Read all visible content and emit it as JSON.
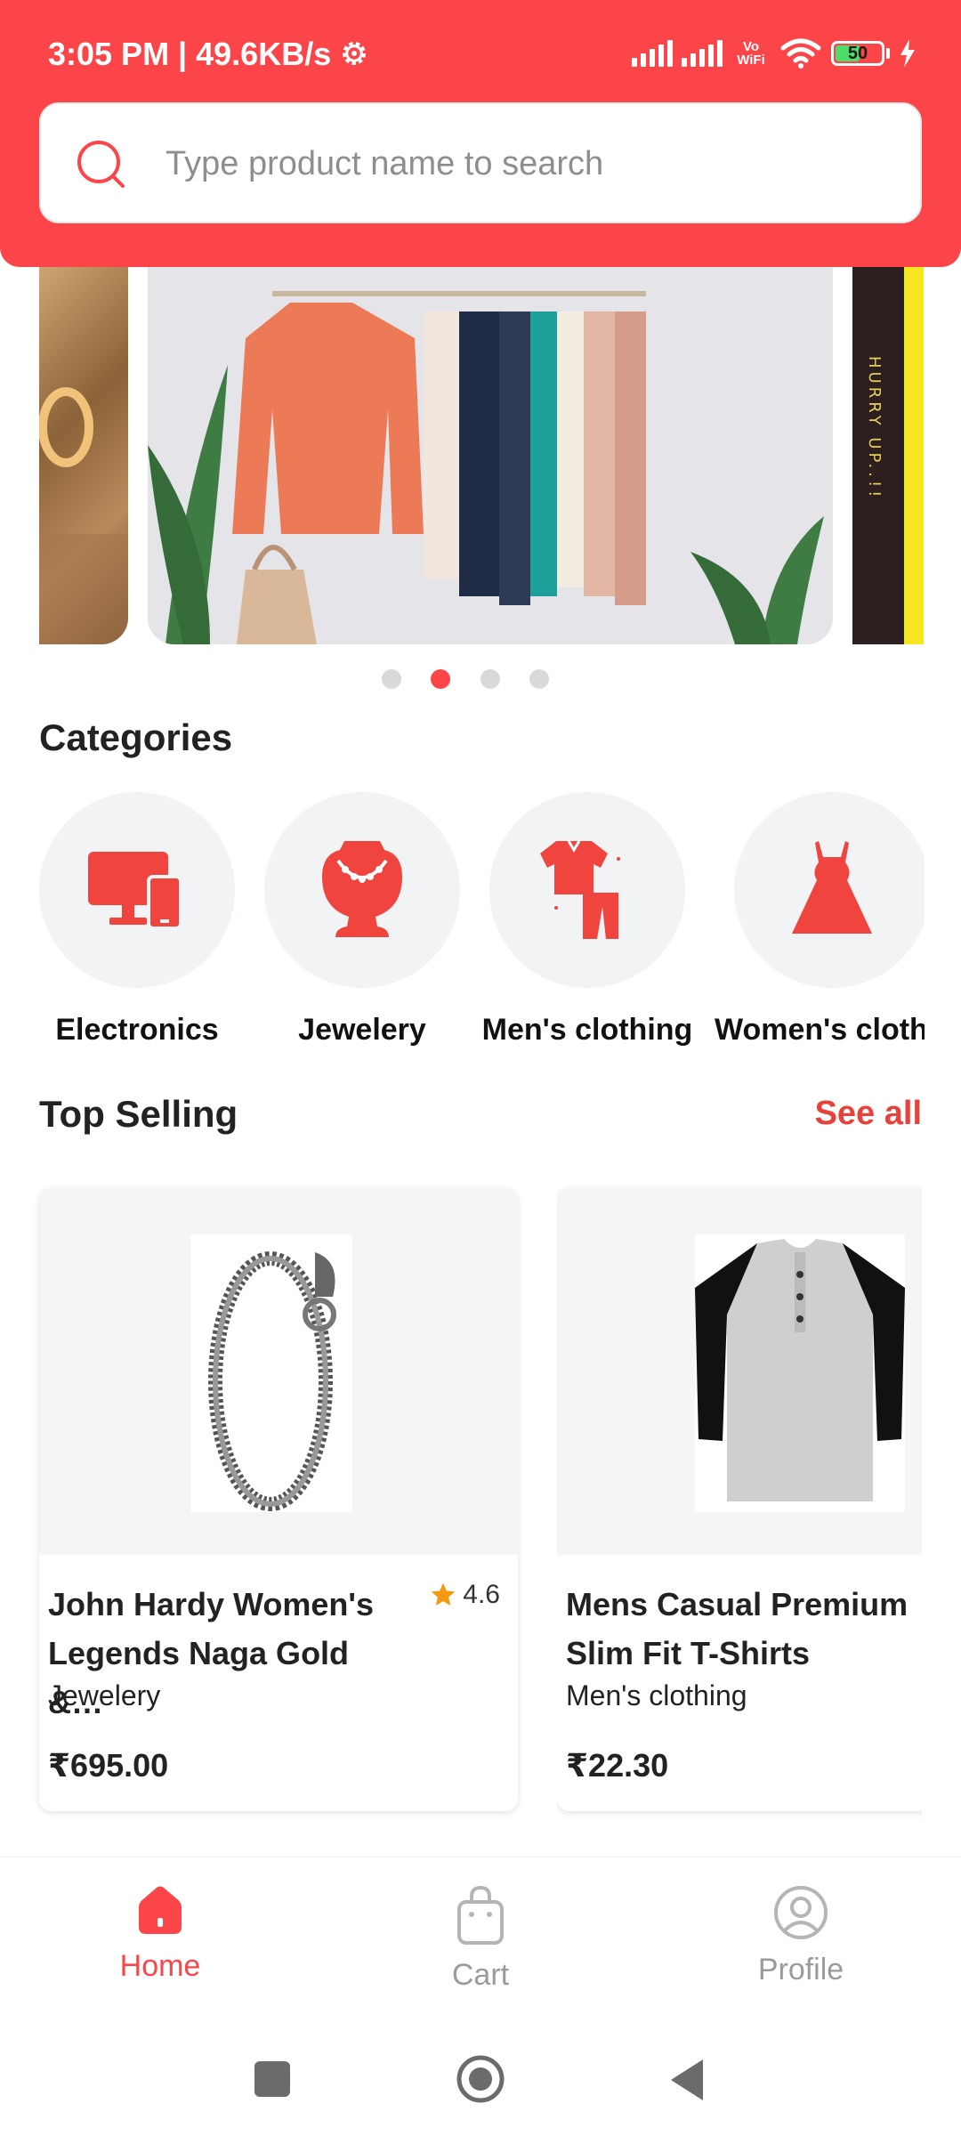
{
  "status": {
    "time": "3:05 PM | 49.6KB/s",
    "network_label": "Vo WiFi",
    "battery": "50"
  },
  "search": {
    "placeholder": "Type product name to search"
  },
  "carousel": {
    "right_slide_text": "HURRY UP..!!",
    "active_index": 1,
    "count": 4
  },
  "categories": {
    "title": "Categories",
    "items": [
      {
        "label": "Electronics",
        "icon": "electronics-icon"
      },
      {
        "label": "Jewelery",
        "icon": "jewelry-necklace-icon"
      },
      {
        "label": "Men's clothing",
        "icon": "mens-clothing-icon"
      },
      {
        "label": "Women's clothin",
        "icon": "dress-icon"
      }
    ]
  },
  "top_selling": {
    "title": "Top Selling",
    "see_all": "See all",
    "products": [
      {
        "name": "John Hardy Women's Legends Naga Gold &…",
        "rating": "4.6",
        "category": "Jewelery",
        "price": "₹695.00"
      },
      {
        "name": "Mens Casual Premium Slim Fit T-Shirts",
        "rating": "",
        "category": "Men's clothing",
        "price": "₹22.30"
      }
    ]
  },
  "nav": {
    "home": "Home",
    "cart": "Cart",
    "profile": "Profile"
  },
  "colors": {
    "brand": "#fb4548",
    "accent_text": "#e8413c",
    "inactive": "#9a9a9a"
  }
}
